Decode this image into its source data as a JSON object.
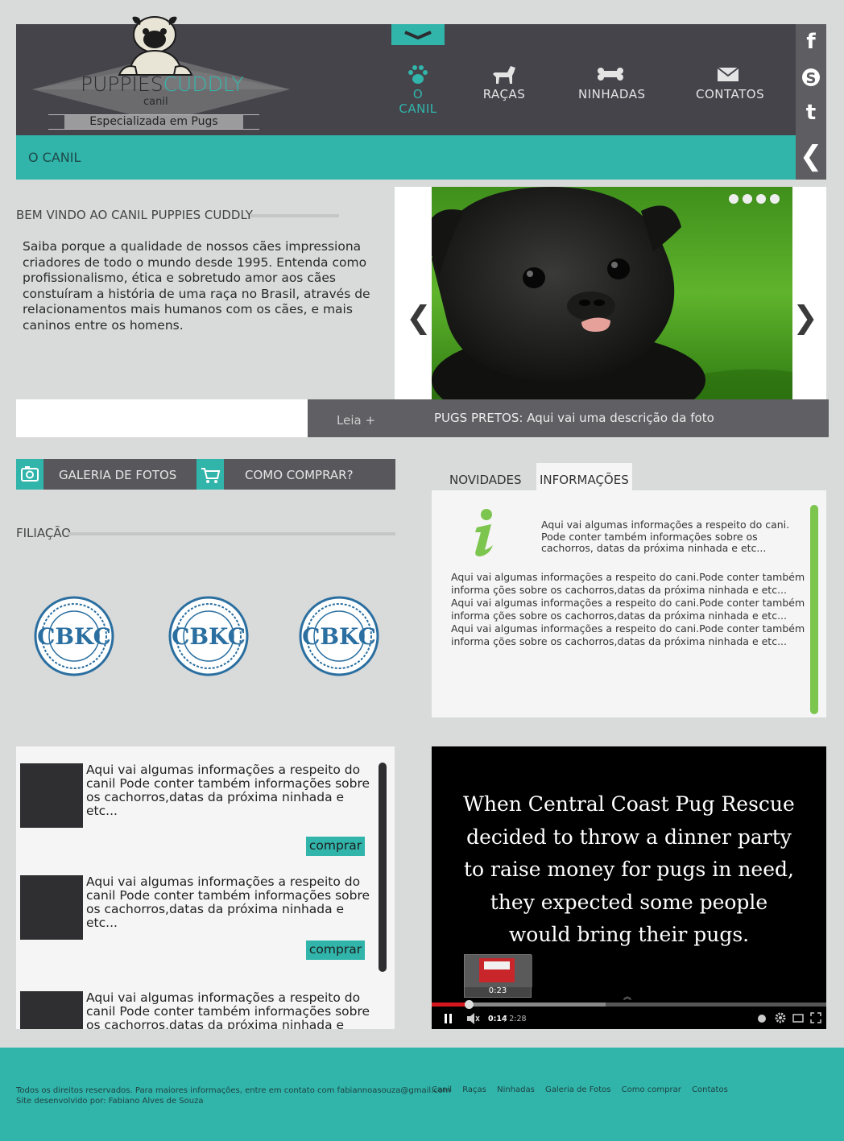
{
  "brand": {
    "name_part1": "PUPPIES",
    "name_part2": "CUDDLY",
    "subtitle": "canil",
    "tagline": "Especializada em Pugs"
  },
  "nav": {
    "items": [
      {
        "label": "O CANIL",
        "icon": "paw-icon",
        "active": true
      },
      {
        "label": "RAÇAS",
        "icon": "dog-icon",
        "active": false
      },
      {
        "label": "NINHADAS",
        "icon": "bone-icon",
        "active": false
      },
      {
        "label": "CONTATOS",
        "icon": "envelope-icon",
        "active": false
      }
    ]
  },
  "social": [
    "facebook-icon",
    "skype-icon",
    "twitter-icon"
  ],
  "breadcrumb": {
    "label": "O CANIL",
    "back_icon": "chevron-left-icon"
  },
  "welcome": {
    "title": "BEM VINDO AO CANIL PUPPIES CUDDLY",
    "text": "Saiba porque a qualidade de nossos cães impressiona criadores de todo o mundo desde 1995. Entenda como profissionalismo, ética e sobretudo amor aos cães constuíram a história de uma raça no Brasil, através de relacionamentos mais humanos com os cães, e mais caninos entre os homens.",
    "read_more": "Leia +"
  },
  "slider": {
    "caption": "PUGS PRETOS: Aqui vai uma descrição da foto",
    "prev_icon": "chevron-left-icon",
    "next_icon": "chevron-right-icon",
    "dot_count": 4
  },
  "quick_links": {
    "gallery": "GALERIA DE FOTOS",
    "how_to_buy": "COMO COMPRAR?"
  },
  "filiacao": {
    "title": "FILIAÇÃO",
    "seals": [
      "CBKC",
      "CBKC",
      "CBKC"
    ]
  },
  "tabs": {
    "items": [
      "NOVIDADES",
      "INFORMAÇÕES"
    ],
    "active": "INFORMAÇÕES"
  },
  "info": {
    "top_text": "Aqui vai algumas informações a respeito do cani. Pode conter também informações sobre os cachorros, datas da próxima ninhada e etc...",
    "paragraphs": [
      "Aqui vai algumas informações a respeito do cani.Pode conter também informa ções sobre os cachorros,datas da próxima ninhada e etc...",
      "Aqui vai algumas informações a respeito do cani.Pode conter também informa ções sobre os cachorros,datas da próxima ninhada e etc...",
      "Aqui vai algumas informações a respeito do cani.Pode conter também informa ções sobre os cachorros,datas da próxima ninhada e etc..."
    ]
  },
  "products": {
    "items": [
      {
        "text": "Aqui vai algumas informações a respeito do canil Pode conter também informações sobre os cachorros,datas da próxima ninhada e etc...",
        "button": "comprar"
      },
      {
        "text": "Aqui vai algumas informações a respeito do canil Pode conter também informações sobre os cachorros,datas da próxima ninhada e etc...",
        "button": "comprar"
      },
      {
        "text": "Aqui vai algumas informações a respeito do canil Pode conter também informações sobre os cachorros,datas da próxima ninhada e etc...",
        "button": ""
      }
    ]
  },
  "video": {
    "lines": [
      "When Central Coast Pug Rescue",
      "decided to throw a dinner party",
      "to raise money for pugs in need,",
      "they expected some people",
      "would bring their pugs."
    ],
    "preview_time": "0:23",
    "current_time": "0:14",
    "duration": "/ 2:28",
    "progress": 0.094,
    "buffered": 0.44
  },
  "footer": {
    "rights": "Todos os direitos reservados. Para maiores informações, entre em contato com fabiannoasouza@gmail.com",
    "credit": "Site desenvolvido por: Fabiano Alves de Souza",
    "links": [
      "Canil",
      "Raças",
      "Ninhadas",
      "Galeria de Fotos",
      "Como comprar",
      "Contatos"
    ]
  },
  "colors": {
    "accent": "#31b5ab",
    "header_bg": "#45444b",
    "page_bg": "#d9dada",
    "info_scroll": "#7cc54e"
  }
}
